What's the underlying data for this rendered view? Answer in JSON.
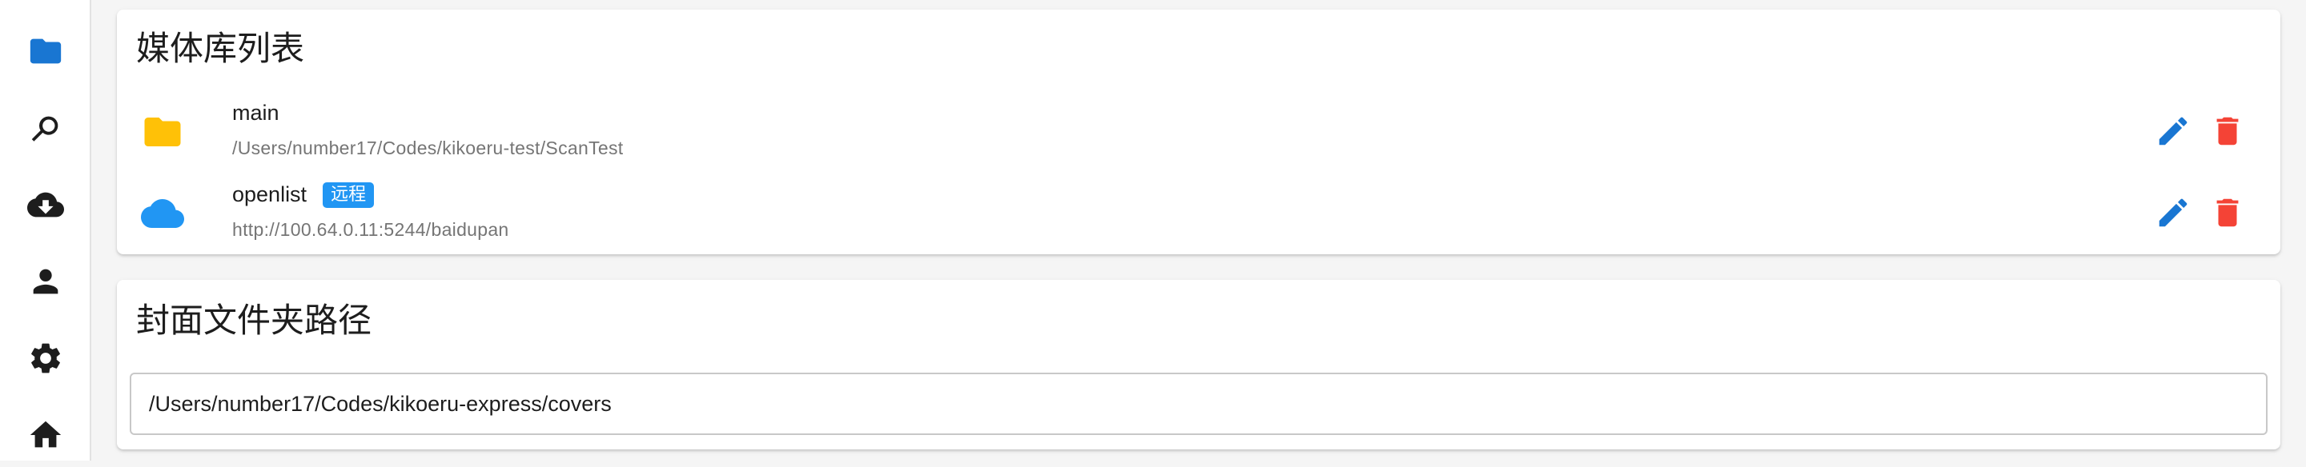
{
  "colors": {
    "sidebar_icon": "#1976d2",
    "sidebar_icon_dark": "#1d1d1d",
    "folder_icon": "#ffc107",
    "cloud_icon": "#2196f3",
    "edit_icon": "#1976d2",
    "delete_icon": "#f44336",
    "badge_bg": "#2196f3"
  },
  "sidebar": {
    "items": [
      {
        "icon": "folder-icon",
        "active": true
      },
      {
        "icon": "search-icon",
        "active": false
      },
      {
        "icon": "cloud-download-icon",
        "active": false
      },
      {
        "icon": "person-icon",
        "active": false
      },
      {
        "icon": "gear-icon",
        "active": false
      },
      {
        "icon": "home-icon",
        "active": false
      }
    ]
  },
  "libraries": {
    "title": "媒体库列表",
    "items": [
      {
        "name": "main",
        "path": "/Users/number17/Codes/kikoeru-test/ScanTest",
        "icon": "folder-icon",
        "badge": ""
      },
      {
        "name": "openlist",
        "path": "http://100.64.0.11:5244/baidupan",
        "icon": "cloud-icon",
        "badge": "远程"
      }
    ]
  },
  "cover": {
    "title": "封面文件夹路径",
    "value": "/Users/number17/Codes/kikoeru-express/covers"
  }
}
